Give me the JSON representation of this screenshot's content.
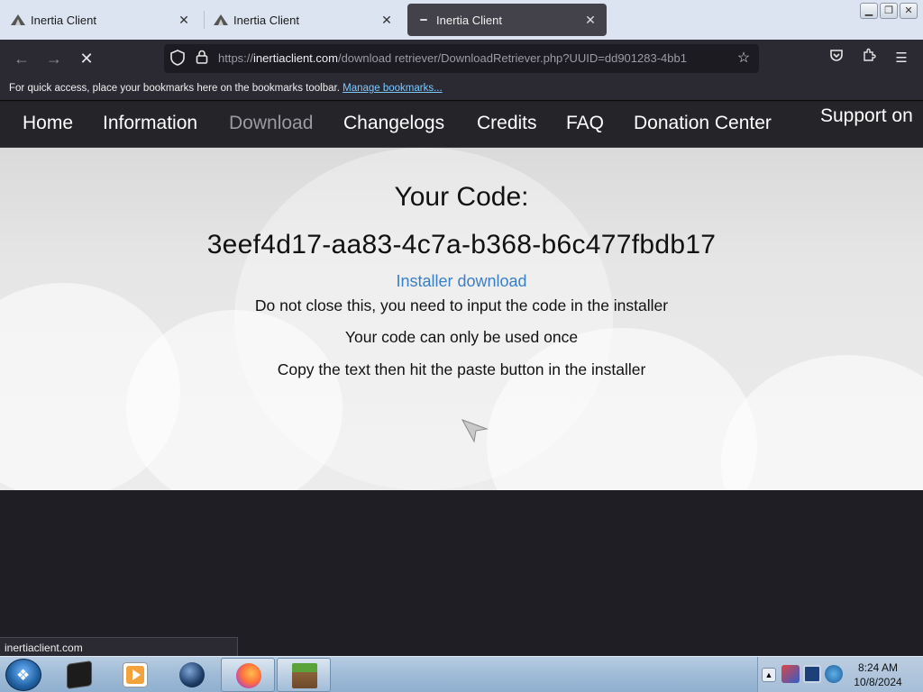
{
  "browser": {
    "tabs": [
      {
        "title": "Inertia Client",
        "active": false
      },
      {
        "title": "Inertia Client",
        "active": false
      },
      {
        "title": "Inertia Client",
        "active": true
      }
    ],
    "url": {
      "scheme": "https://",
      "domain": "inertiaclient.com",
      "path": "/download retriever/DownloadRetriever.php?UUID=dd901283-4bb1"
    },
    "bookmarks_bar": {
      "text": "For quick access, place your bookmarks here on the bookmarks toolbar.",
      "link": "Manage bookmarks..."
    },
    "status_url": "inertiaclient.com"
  },
  "site": {
    "nav": {
      "home": "Home",
      "information": "Information",
      "download": "Download",
      "changelogs": "Changelogs",
      "credits": "Credits",
      "faq": "FAQ",
      "donation": "Donation Center",
      "support": "Support on"
    },
    "heading": "Your Code:",
    "code": "3eef4d17-aa83-4c7a-b368-b6c477fbdb17",
    "installer_link": "Installer download",
    "notes": [
      "Do not close this, you need to input the code in the installer",
      "Your code can only be used once",
      "Copy the text then hit the paste button in the installer"
    ]
  },
  "taskbar": {
    "time": "8:24 AM",
    "date": "10/8/2024"
  },
  "colors": {
    "browser_chrome": "#2b2a33",
    "site_nav": "#252429",
    "link_blue": "#3b7fc4",
    "taskbar": "#9fbad6"
  }
}
